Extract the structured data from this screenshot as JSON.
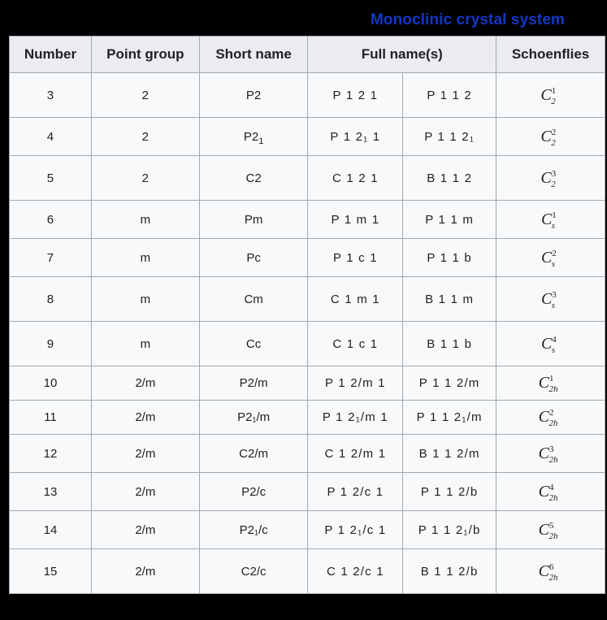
{
  "title": "Monoclinic crystal system",
  "title_color": "#1437c4",
  "background_color": "#000000",
  "table": {
    "headers": [
      {
        "label": "Number",
        "is_link": false
      },
      {
        "label": "Point group",
        "is_link": true
      },
      {
        "label": "Short name",
        "is_link": false
      },
      {
        "label": "Full name(s)",
        "is_link": false
      },
      {
        "label": "Schoenflies",
        "is_link": true
      }
    ],
    "rows": [
      {
        "number": "3",
        "point_group": "2",
        "short_name": "P2",
        "short_sub": "",
        "full_a": "P 1 2 1",
        "full_b": "P 1 1 2",
        "schoen_base": "C",
        "schoen_sup": "1",
        "schoen_sub": "2",
        "height": "tall"
      },
      {
        "number": "4",
        "point_group": "2",
        "short_name": "P2",
        "short_sub": "1",
        "full_a": "P 1 2₁ 1",
        "full_b": "P 1 1 2₁",
        "schoen_base": "C",
        "schoen_sup": "2",
        "schoen_sub": "2",
        "height": "mid"
      },
      {
        "number": "5",
        "point_group": "2",
        "short_name": "C2",
        "short_sub": "",
        "full_a": "C 1 2 1",
        "full_b": "B 1 1 2",
        "schoen_base": "C",
        "schoen_sup": "3",
        "schoen_sub": "2",
        "height": "tall"
      },
      {
        "number": "6",
        "point_group": "m",
        "short_name": "Pm",
        "short_sub": "",
        "full_a": "P 1 m 1",
        "full_b": "P 1 1 m",
        "schoen_base": "C",
        "schoen_sup": "1",
        "schoen_sub": "s",
        "height": "mid"
      },
      {
        "number": "7",
        "point_group": "m",
        "short_name": "Pc",
        "short_sub": "",
        "full_a": "P 1 c 1",
        "full_b": "P 1 1 b",
        "schoen_base": "C",
        "schoen_sup": "2",
        "schoen_sub": "s",
        "height": "mid"
      },
      {
        "number": "8",
        "point_group": "m",
        "short_name": "Cm",
        "short_sub": "",
        "full_a": "C 1 m 1",
        "full_b": "B 1 1 m",
        "schoen_base": "C",
        "schoen_sup": "3",
        "schoen_sub": "s",
        "height": "tall"
      },
      {
        "number": "9",
        "point_group": "m",
        "short_name": "Cc",
        "short_sub": "",
        "full_a": "C 1 c 1",
        "full_b": "B 1 1 b",
        "schoen_base": "C",
        "schoen_sup": "4",
        "schoen_sub": "s",
        "height": "tall"
      },
      {
        "number": "10",
        "point_group": "2/m",
        "short_name": "P2/m",
        "short_sub": "",
        "full_a": "P 1 2/m 1",
        "full_b": "P 1 1 2/m",
        "schoen_base": "C",
        "schoen_sup": "1",
        "schoen_sub": "2h",
        "height": "short"
      },
      {
        "number": "11",
        "point_group": "2/m",
        "short_name": "P2₁/m",
        "short_sub": "",
        "full_a": "P 1 2₁/m 1",
        "full_b": "P 1 1 2₁/m",
        "schoen_base": "C",
        "schoen_sup": "2",
        "schoen_sub": "2h",
        "height": "short"
      },
      {
        "number": "12",
        "point_group": "2/m",
        "short_name": "C2/m",
        "short_sub": "",
        "full_a": "C 1 2/m 1",
        "full_b": "B 1 1 2/m",
        "schoen_base": "C",
        "schoen_sup": "3",
        "schoen_sub": "2h",
        "height": "mid"
      },
      {
        "number": "13",
        "point_group": "2/m",
        "short_name": "P2/c",
        "short_sub": "",
        "full_a": "P 1 2/c 1",
        "full_b": "P 1 1 2/b",
        "schoen_base": "C",
        "schoen_sup": "4",
        "schoen_sub": "2h",
        "height": "mid"
      },
      {
        "number": "14",
        "point_group": "2/m",
        "short_name": "P2₁/c",
        "short_sub": "",
        "full_a": "P 1 2₁/c 1",
        "full_b": "P 1 1 2₁/b",
        "schoen_base": "C",
        "schoen_sup": "5",
        "schoen_sub": "2h",
        "height": "mid"
      },
      {
        "number": "15",
        "point_group": "2/m",
        "short_name": "C2/c",
        "short_sub": "",
        "full_a": "C 1 2/c 1",
        "full_b": "B 1 1 2/b",
        "schoen_base": "C",
        "schoen_sup": "6",
        "schoen_sub": "2h",
        "height": "tall"
      }
    ]
  }
}
